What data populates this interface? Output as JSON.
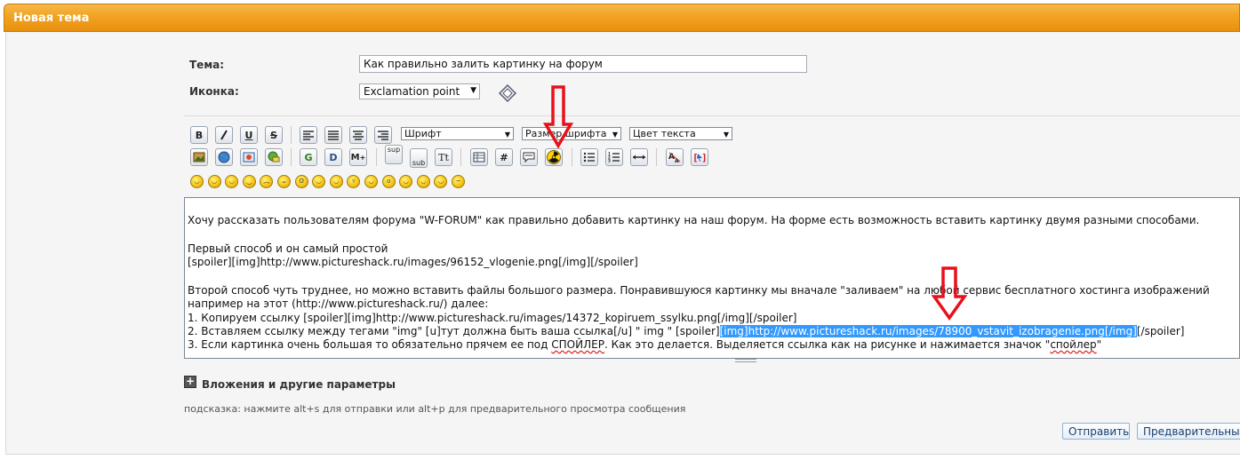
{
  "panel": {
    "title": "Новая тема"
  },
  "form": {
    "subject_label": "Тема:",
    "subject_value": "Как правильно залить картинку на форум",
    "icon_label": "Иконка:",
    "icon_value": "Exclamation point"
  },
  "toolbar": {
    "font_select": "Шрифт",
    "size_select": "Размер шрифта",
    "color_select": "Цвет текста",
    "sup": "sup",
    "sub": "sub",
    "tt": "Tt",
    "bold": "B",
    "underline": "U",
    "strike": "S",
    "google": "G",
    "d_btn": "D",
    "m_btn": "M",
    "hash": "#"
  },
  "editor": {
    "line1": "Хочу рассказать пользователям форума \"W-FORUM\" как правильно добавить картинку на наш форум. На форме есть возможность вставить картинку двумя разными способами.",
    "line2": "Первый способ и он самый простой",
    "line3": "[spoiler][img]http://www.pictureshack.ru/images/96152_vlogenie.png[/img][/spoiler]",
    "line4": "Второй способ чуть труднее, но можно вставить файлы большого размера. Понравившуюся картинку мы вначале \"заливаем\"  на любой сервис бесплатного хостинга изображений",
    "line5": "например  на этот (http://www.pictureshack.ru/) далее:",
    "line6": "1. Копируем ссылку [spoiler][img]http://www.pictureshack.ru/images/14372_kopiruem_ssylku.png[/img][/spoiler]",
    "line7_pre": "2. Вставляем ссылку между тегами \"img\" [u]тут должна быть ваша ссылка[/u] \" img \"   [spoiler]",
    "line7_sel": "[img]http://www.pictureshack.ru/images/78900_vstavit_izobragenie.png[/img]",
    "line7_post": "[/spoiler]",
    "line8_pre": "3. Если картинка очень большая то обязательно прячем ее под ",
    "line8_spoiler": "СПОЙЛЕР",
    "line8_mid": ". Как это делается. Выделяется ссылка как на рисунке и нажимается значок \"",
    "line8_word": "спойлер",
    "line8_end": "\""
  },
  "attachments": {
    "label": "Вложения и другие параметры"
  },
  "hint": "подсказка: нажмите alt+s для отправки или alt+p для предварительного просмотра сообщения",
  "buttons": {
    "submit": "Отправить",
    "preview": "Предварительный"
  },
  "colors": {
    "header": "#f1a321",
    "selection": "#3399ff",
    "arrow": "#e8101a"
  }
}
